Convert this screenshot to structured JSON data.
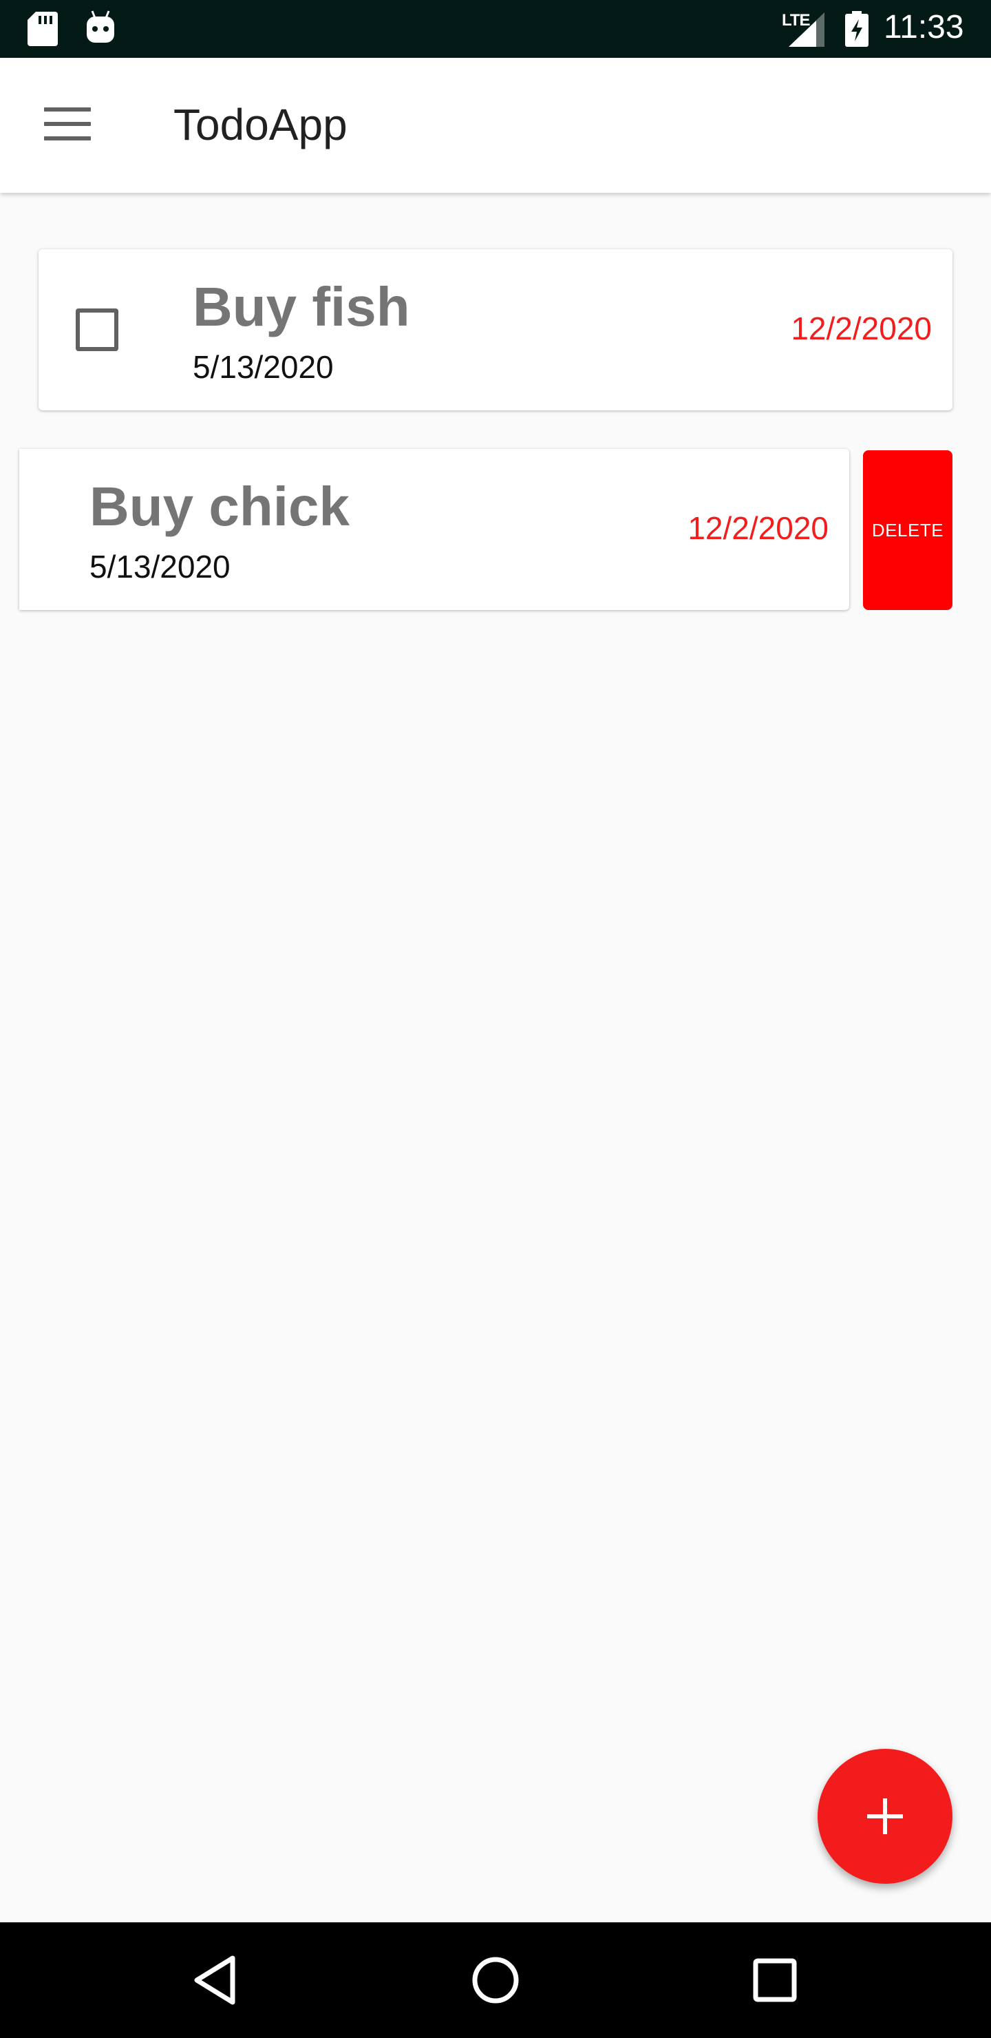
{
  "status_bar": {
    "time": "11:33",
    "network": "LTE",
    "icons": [
      "sd-card-icon",
      "android-icon",
      "signal-icon",
      "battery-charging-icon"
    ]
  },
  "app_bar": {
    "title": "TodoApp",
    "menu_icon": "hamburger-menu-icon"
  },
  "todos": [
    {
      "title": "Buy fish",
      "created": "5/13/2020",
      "due": "12/2/2020",
      "checked": false
    },
    {
      "title": "Buy chick",
      "created": "5/13/2020",
      "due": "12/2/2020",
      "swiped": true
    }
  ],
  "swipe_action": {
    "label": "DELETE",
    "color": "#ff0000"
  },
  "fab": {
    "icon": "plus-icon",
    "color": "#f31c1c"
  },
  "nav_bar": {
    "icons": [
      "back-icon",
      "home-icon",
      "recents-icon"
    ]
  },
  "colors": {
    "accent": "#f31c1c",
    "due_date": "#f21d1d",
    "status_bar": "#031a17",
    "background": "#fafafa"
  }
}
